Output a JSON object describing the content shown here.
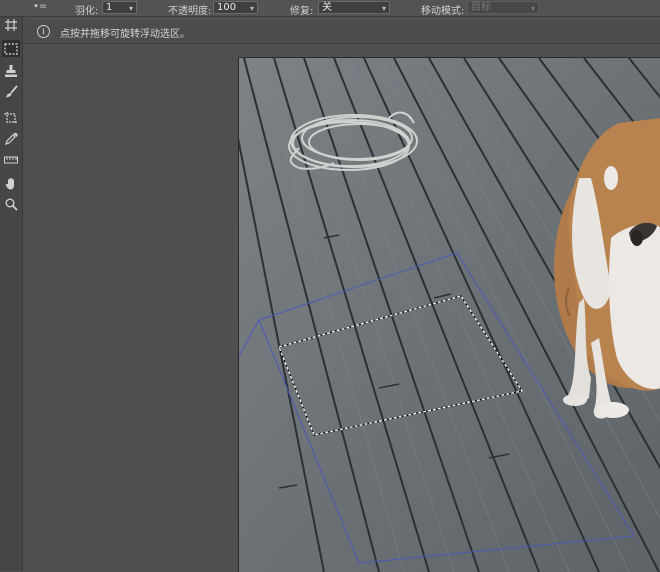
{
  "options_bar": {
    "feather_label": "羽化:",
    "feather_value": "1",
    "opacity_label": "不透明度:",
    "opacity_value": "100",
    "repair_label": "修复:",
    "repair_value": "关",
    "move_mode_label": "移动模式:",
    "move_mode_value": "目标"
  },
  "info_bar": {
    "icon_glyph": "i",
    "message": "点按并拖移可旋转浮动选区。"
  },
  "toolbar": {
    "tools": [
      {
        "name": "move-tool-icon"
      },
      {
        "name": "artboard-tool-icon"
      },
      {
        "name": "rectangular-marquee-tool-icon",
        "active": true
      },
      {
        "name": "clone-stamp-tool-icon"
      },
      {
        "name": "brush-tool-icon"
      },
      {
        "name": "perspective-crop-tool-icon"
      },
      {
        "name": "eyedropper-tool-icon"
      },
      {
        "name": "ruler-tool-icon"
      },
      {
        "name": "hand-tool-icon"
      },
      {
        "name": "zoom-tool-icon"
      }
    ]
  },
  "colors": {
    "panel_bg": "#4f4f4f",
    "deck_wood": "#6e7478",
    "plank_gap": "#2c3033",
    "selection_outline": "#ffffff",
    "transform_guide": "#4a5ab8",
    "dog_fur_tan": "#b07a4a",
    "dog_fur_white": "#e8e4e0"
  }
}
